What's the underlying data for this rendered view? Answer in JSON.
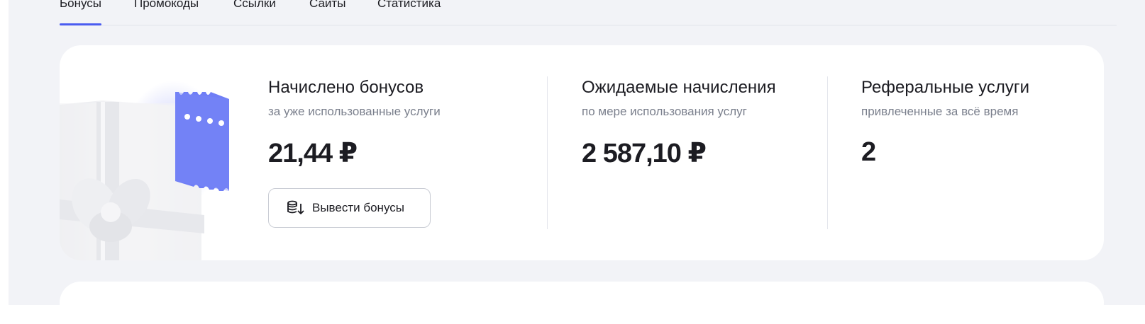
{
  "tabs": [
    {
      "label": "Бонусы",
      "active": true
    },
    {
      "label": "Промокоды",
      "active": false
    },
    {
      "label": "Ссылки",
      "active": false
    },
    {
      "label": "Сайты",
      "active": false
    },
    {
      "label": "Статистика",
      "active": false
    }
  ],
  "stats": {
    "accrued": {
      "title": "Начислено бонусов",
      "subtitle": "за уже использованные услуги",
      "value": "21,44 ₽"
    },
    "expected": {
      "title": "Ожидаемые начисления",
      "subtitle": "по мере использования услуг",
      "value": "2 587,10 ₽"
    },
    "referral": {
      "title": "Реферальные услуги",
      "subtitle": "привлеченные за всё время",
      "value": "2"
    }
  },
  "withdraw_button": {
    "label": "Вывести бонусы",
    "icon": "coins-withdraw-icon"
  },
  "illustration": {
    "icon": "gift-ticket-illustration"
  },
  "colors": {
    "accent": "#4a5cf0",
    "ticket": "#7280f5",
    "background": "#f2f3f7",
    "card": "#ffffff",
    "muted_text": "#7a7f8c"
  }
}
